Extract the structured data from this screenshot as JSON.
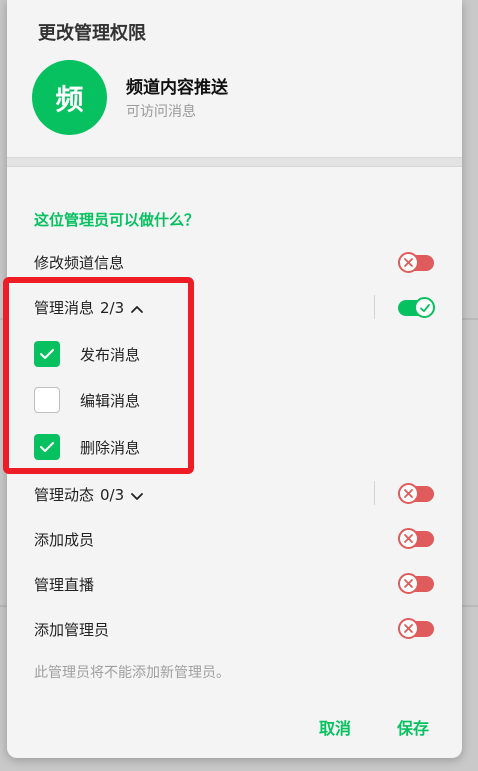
{
  "dialog": {
    "title": "更改管理权限",
    "channel": {
      "avatar_char": "频",
      "name": "频道内容推送",
      "subtitle": "可访问消息"
    },
    "section_title": "这位管理员可以做什么？",
    "permissions": {
      "edit_channel": {
        "label": "修改频道信息",
        "enabled": false
      },
      "manage_messages": {
        "label": "管理消息",
        "count": "2/3",
        "enabled": true,
        "expanded": true,
        "items": [
          {
            "label": "发布消息",
            "checked": true
          },
          {
            "label": "编辑消息",
            "checked": false
          },
          {
            "label": "删除消息",
            "checked": true
          }
        ]
      },
      "manage_stories": {
        "label": "管理动态",
        "count": "0/3",
        "enabled": false,
        "expanded": false
      },
      "add_members": {
        "label": "添加成员",
        "enabled": false
      },
      "manage_live": {
        "label": "管理直播",
        "enabled": false
      },
      "add_admins": {
        "label": "添加管理员",
        "enabled": false
      }
    },
    "hint": "此管理员将不能添加新管理员。",
    "cancel_label": "取消",
    "save_label": "保存"
  },
  "colors": {
    "accent": "#07c160",
    "danger": "#e05b5b",
    "highlight": "#ee1c25"
  },
  "icons": {
    "toggle_off": "x-icon",
    "toggle_on": "check-icon",
    "expanded": "chevron-up-icon",
    "collapsed": "chevron-down-icon"
  }
}
